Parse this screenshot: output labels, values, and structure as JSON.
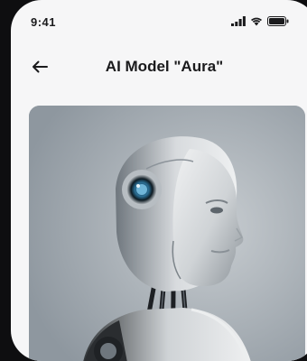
{
  "status_bar": {
    "time": "9:41",
    "icons": [
      "signal-icon",
      "wifi-icon",
      "battery-icon"
    ]
  },
  "nav": {
    "back_icon": "arrow-left-icon",
    "title": "AI Model \"Aura\""
  },
  "hero": {
    "image": "humanoid-robot-portrait"
  },
  "colors": {
    "background": "#f6f6f7",
    "title_text": "#1a1a1c",
    "image_bg": "#a9b0b6"
  }
}
